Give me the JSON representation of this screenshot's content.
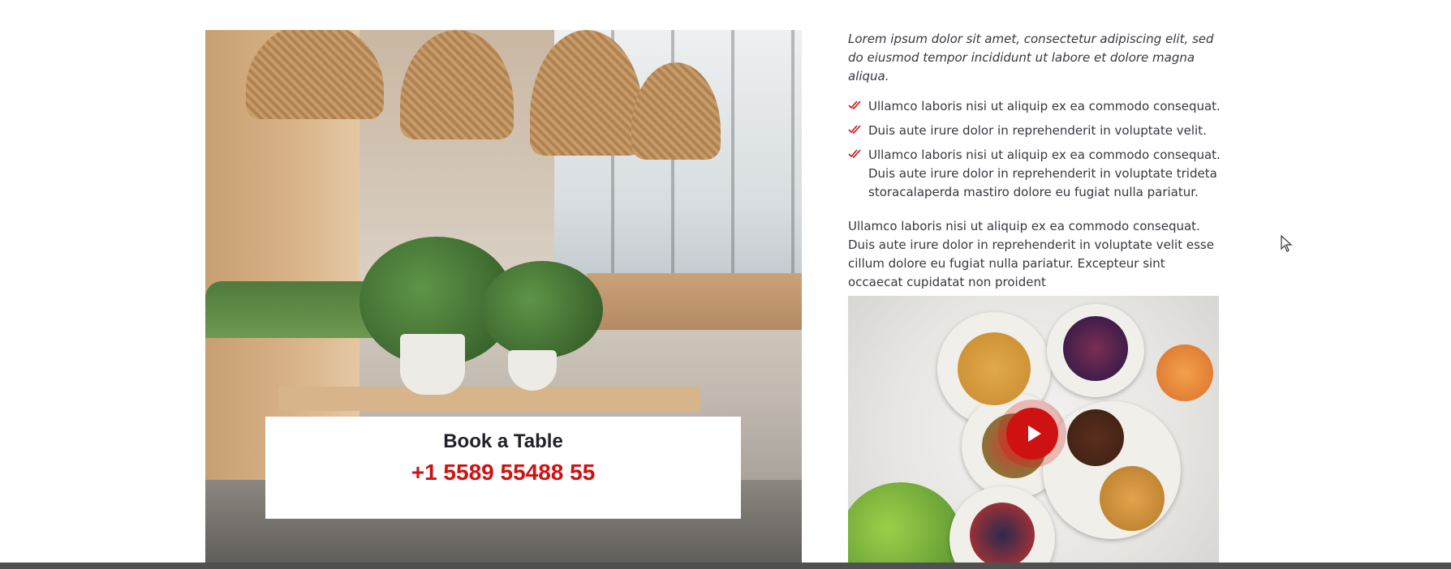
{
  "about": {
    "book": {
      "title": "Book a Table",
      "phone": "+1 5589 55488 55"
    },
    "lead": "Lorem ipsum dolor sit amet, consectetur adipiscing elit, sed do eiusmod tempor incididunt ut labore et dolore magna aliqua.",
    "checks": [
      "Ullamco laboris nisi ut aliquip ex ea commodo consequat.",
      "Duis aute irure dolor in reprehenderit in voluptate velit.",
      "Ullamco laboris nisi ut aliquip ex ea commodo consequat. Duis aute irure dolor in reprehenderit in voluptate trideta storacalaperda mastiro dolore eu fugiat nulla pariatur."
    ],
    "paragraph": "Ullamco laboris nisi ut aliquip ex ea commodo consequat. Duis aute irure dolor in reprehenderit in voluptate velit esse cillum dolore eu fugiat nulla pariatur. Excepteur sint occaecat cupidatat non proident",
    "icons": {
      "check": "double-check-icon",
      "play": "play-icon",
      "cursor": "mouse-cursor-icon"
    }
  },
  "colors": {
    "accent": "#ce1212",
    "heading": "#212129",
    "text": "#37373f"
  }
}
